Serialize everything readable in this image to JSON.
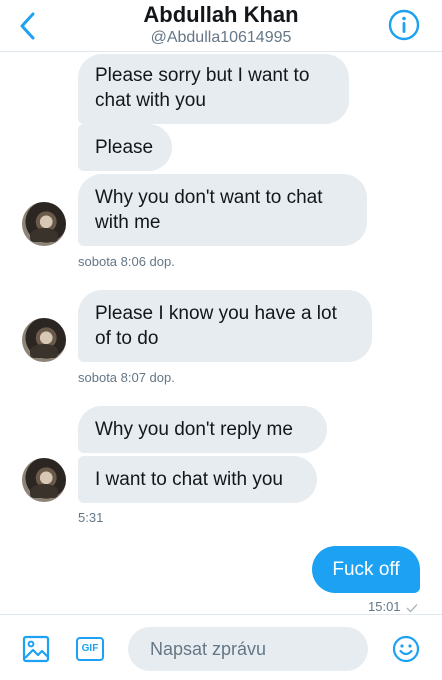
{
  "header": {
    "title": "Abdullah Khan",
    "handle": "@Abdulla10614995"
  },
  "messages": [
    {
      "text_lines": [
        "Please sorry but I want to",
        "chat with you"
      ]
    },
    {
      "text": "Please"
    },
    {
      "text_lines": [
        "Why you don't want to chat",
        "with me"
      ]
    },
    {
      "text_lines": [
        "Please I know you have a lot",
        "of to do"
      ]
    },
    {
      "text": "Why you don't reply me"
    },
    {
      "text": "I want to chat with you"
    },
    {
      "text": "Fuck off"
    }
  ],
  "timestamps": [
    "sobota 8:06 dop.",
    "sobota 8:07 dop.",
    "5:31",
    "15:01"
  ],
  "composer": {
    "placeholder": "Napsat zprávu",
    "gif_label": "GIF"
  },
  "colors": {
    "accent": "#1da1f2",
    "incoming_bubble": "#e6ecf0",
    "meta_text": "#657786"
  },
  "icons": [
    "back-chevron-icon",
    "info-icon",
    "image-icon",
    "gif-icon",
    "emoji-icon",
    "read-check-icon"
  ]
}
